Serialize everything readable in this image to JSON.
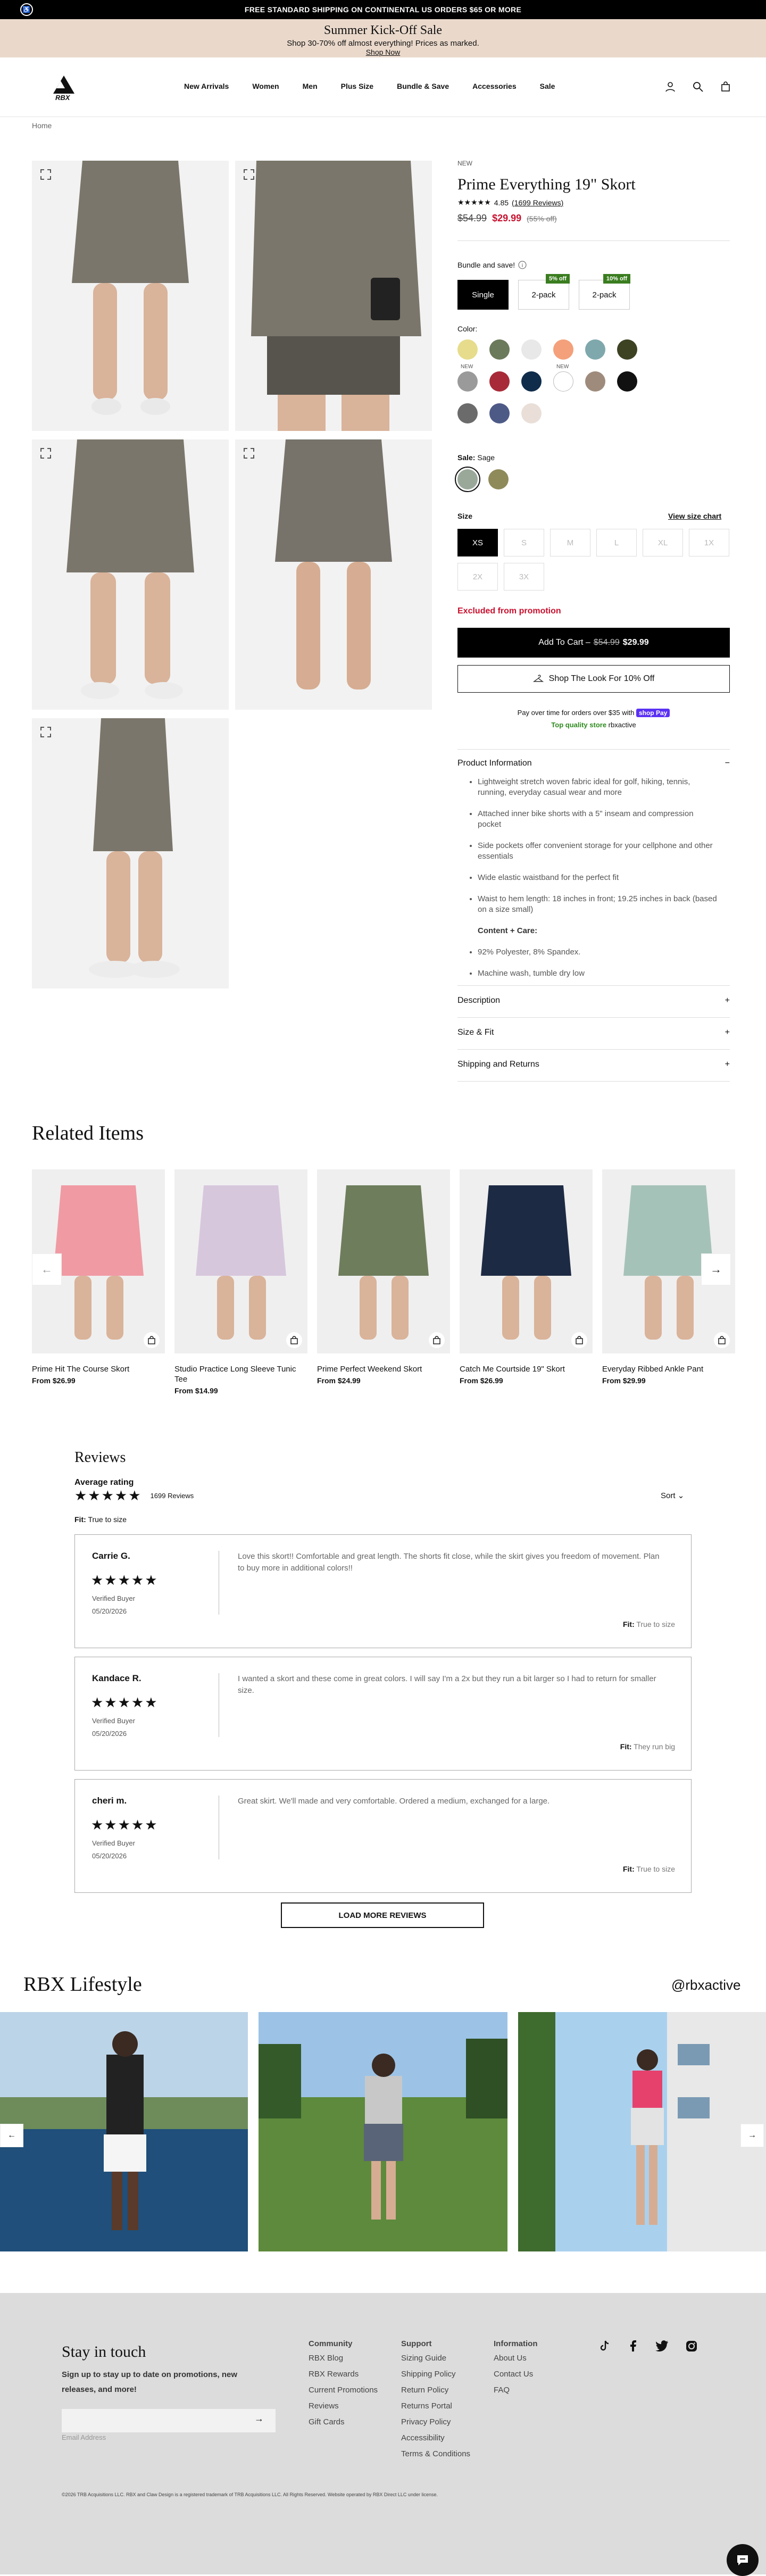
{
  "topbar": {
    "text": "FREE STANDARD SHIPPING ON CONTINENTAL US ORDERS $65 OR MORE"
  },
  "promo": {
    "title": "Summer Kick-Off Sale",
    "subtitle": "Shop 30-70% off almost everything! Prices as marked.",
    "link": "Shop Now"
  },
  "header": {
    "logo_text": "RBX",
    "nav": [
      "New Arrivals",
      "Women",
      "Men",
      "Plus Size",
      "Bundle & Save",
      "Accessories",
      "Sale"
    ]
  },
  "breadcrumb": "Home",
  "product": {
    "badge": "NEW",
    "title": "Prime Everything 19\" Skort",
    "stars": "★★★★★",
    "rating": "4.85",
    "reviews_link": "(1699 Reviews)",
    "price_original": "$54.99",
    "price_sale": "$29.99",
    "discount": "(55% off)",
    "bundle_label": "Bundle and save!",
    "bundle_options": [
      {
        "label": "Single",
        "tag": ""
      },
      {
        "label": "2-pack",
        "tag": "5% off"
      },
      {
        "label": "2-pack",
        "tag": "10% off"
      }
    ],
    "color_label": "Color:",
    "color_new": "NEW",
    "colors": [
      "#e6dc8c",
      "#6b7a5a",
      "#e8e8e8",
      "#f4a07a",
      "#7fa8ad",
      "#3d4223",
      "#9a9a9a",
      "#a82a38",
      "#0f2c4a",
      "#ffffff",
      "#9f8b7c",
      "#111111",
      "#6b6b6b",
      "#4e5a86",
      "#e9dfd8"
    ],
    "sale_label": "Sale:",
    "sale_color": "Sage",
    "sale_colors": [
      "#9aa89a",
      "#8f8a5a"
    ],
    "size_label": "Size",
    "size_chart": "View size chart",
    "sizes": [
      "XS",
      "S",
      "M",
      "L",
      "XL",
      "1X",
      "2X",
      "3X"
    ],
    "excluded": "Excluded from promotion",
    "add_to_cart": "Add To Cart –",
    "cart_old": "$54.99",
    "cart_new": "$29.99",
    "shop_look": "Shop The Look For 10% Off",
    "payover": "Pay over time for orders over $35 with",
    "shoppay": "shop Pay",
    "top_quality": "Top quality store",
    "quality_link": "rbxactive",
    "info_title": "Product Information",
    "info_toggle": "−",
    "bullets": [
      "Lightweight stretch woven fabric ideal for golf, hiking, tennis, running, everyday casual wear and more",
      "Attached inner bike shorts with a 5\" inseam and compression pocket",
      "Side pockets offer convenient storage for your cellphone and other essentials",
      "Wide elastic waistband for the perfect fit",
      "Waist to hem length: 18 inches in front; 19.25 inches in back (based on a size small)"
    ],
    "content_title": "Content + Care:",
    "care": [
      "92% Polyester, 8% Spandex.",
      "Machine wash, tumble dry low"
    ],
    "accordions": [
      "Description",
      "Size & Fit",
      "Shipping and Returns"
    ],
    "plus": "+"
  },
  "related": {
    "title": "Related Items",
    "items": [
      {
        "name": "Prime Hit The Course Skort",
        "price": "From $26.99",
        "color": "#f09aa4"
      },
      {
        "name": "Studio Practice Long Sleeve Tunic Tee",
        "price": "From $14.99",
        "color": "#d7c7dd"
      },
      {
        "name": "Prime Perfect Weekend Skort",
        "price": "From $24.99",
        "color": "#6e7d5c"
      },
      {
        "name": "Catch Me Courtside 19\" Skort",
        "price": "From $26.99",
        "color": "#1d2a44"
      },
      {
        "name": "Everyday Ribbed Ankle Pant",
        "price": "From $29.99",
        "color": "#a5c2b8"
      }
    ],
    "prev": "←",
    "next": "→"
  },
  "reviews": {
    "title": "Reviews",
    "avg_label": "Average rating",
    "stars": "★★★★★",
    "count": "1699 Reviews",
    "sort": "Sort",
    "fit_label": "Fit:",
    "fit_value": "True to size",
    "items": [
      {
        "name": "Carrie G.",
        "stars": "★★★★★",
        "verified": "Verified Buyer",
        "date": "05/20/2026",
        "text": "Love this skort!! Comfortable and great length. The shorts fit close, while the skirt gives you freedom of movement. Plan to buy more in additional colors!!",
        "fit": "True to size"
      },
      {
        "name": "Kandace R.",
        "stars": "★★★★★",
        "verified": "Verified Buyer",
        "date": "05/20/2026",
        "text": "I wanted a skort and these come in great colors. I will say I'm a 2x but they run a bit larger so I had to return for smaller size.",
        "fit": "They run big"
      },
      {
        "name": "cheri m.",
        "stars": "★★★★★",
        "verified": "Verified Buyer",
        "date": "05/20/2026",
        "text": "Great skirt. We'll made and very comfortable. Ordered a medium, exchanged for a large.",
        "fit": "True to size"
      }
    ],
    "load_more": "LOAD MORE REVIEWS"
  },
  "lifestyle": {
    "title": "RBX Lifestyle",
    "handle": "@rbxactive",
    "prev": "←",
    "next": "→"
  },
  "footer": {
    "title": "Stay in touch",
    "subtitle": "Sign up to stay up to date on promotions, new releases, and more!",
    "email_placeholder": "Email Address",
    "submit": "→",
    "columns": [
      {
        "heading": "Community",
        "links": [
          "RBX Blog",
          "RBX Rewards",
          "Current Promotions",
          "Reviews",
          "Gift Cards"
        ]
      },
      {
        "heading": "Support",
        "links": [
          "Sizing Guide",
          "Shipping Policy",
          "Return Policy",
          "Returns Portal",
          "Privacy Policy",
          "Accessibility",
          "Terms & Conditions"
        ]
      },
      {
        "heading": "Information",
        "links": [
          "About Us",
          "Contact Us",
          "FAQ"
        ]
      }
    ],
    "copyright": "©2026 TRB Acquisitions LLC. RBX and Claw Design is a registered trademark of TRB Acquisitions LLC. All Rights Reserved. Website operated by RBX Direct LLC under license."
  }
}
